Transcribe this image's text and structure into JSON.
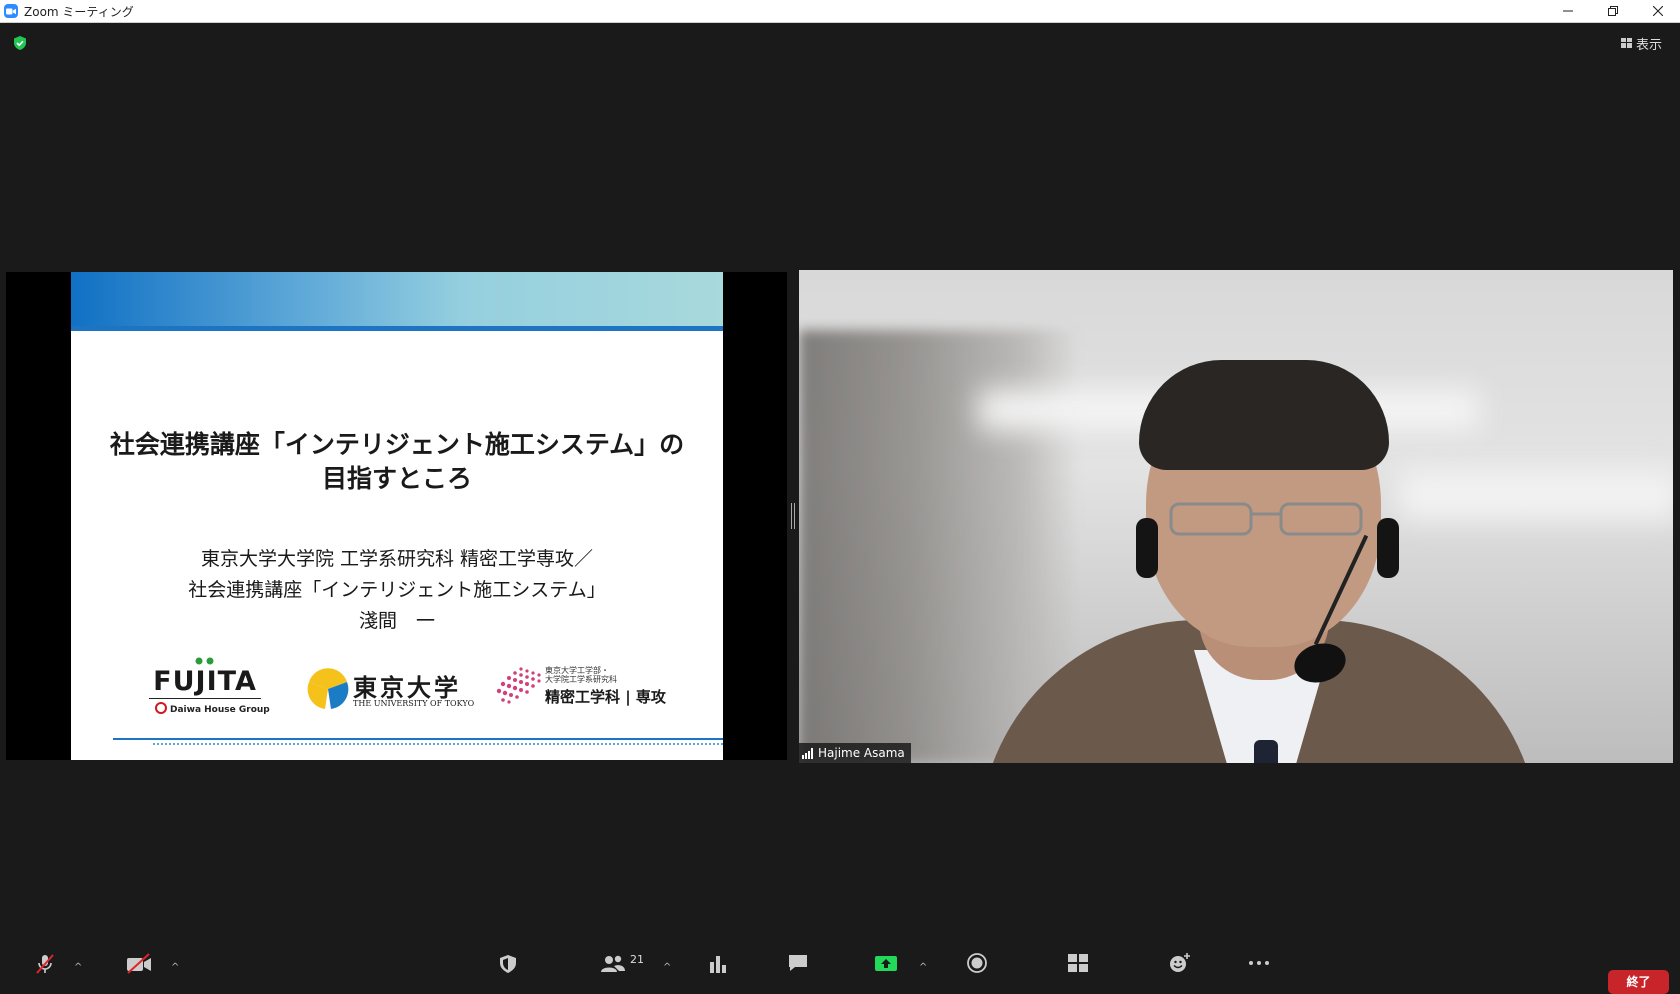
{
  "window": {
    "title": "Zoom ミーティング"
  },
  "top": {
    "view_label": "表示"
  },
  "slide": {
    "title_line1": "社会連携講座「インテリジェント施工システム」の",
    "title_line2": "目指すところ",
    "sub_line1": "東京大学大学院 工学系研究科 精密工学専攻／",
    "sub_line2": "社会連携講座「インテリジェント施工システム」",
    "sub_line3": "淺間　一",
    "logo_fujita": "FUJITA",
    "logo_daiwa": "Daiwa House Group",
    "logo_todai": "東京大学",
    "logo_todai_en": "THE UNIVERSITY OF TOKYO",
    "logo_dept_small_1": "東京大学工学部・",
    "logo_dept_small_2": "大学院工学系研究科",
    "logo_dept_big": "精密工学科 | 専攻"
  },
  "video": {
    "participant_name": "Hajime Asama"
  },
  "toolbar": {
    "participants_count": "21",
    "end_label": "終了"
  },
  "colors": {
    "accent": "#2d8cff",
    "end": "#c8252a",
    "share_green": "#23d959",
    "background": "#1a1a1a"
  }
}
